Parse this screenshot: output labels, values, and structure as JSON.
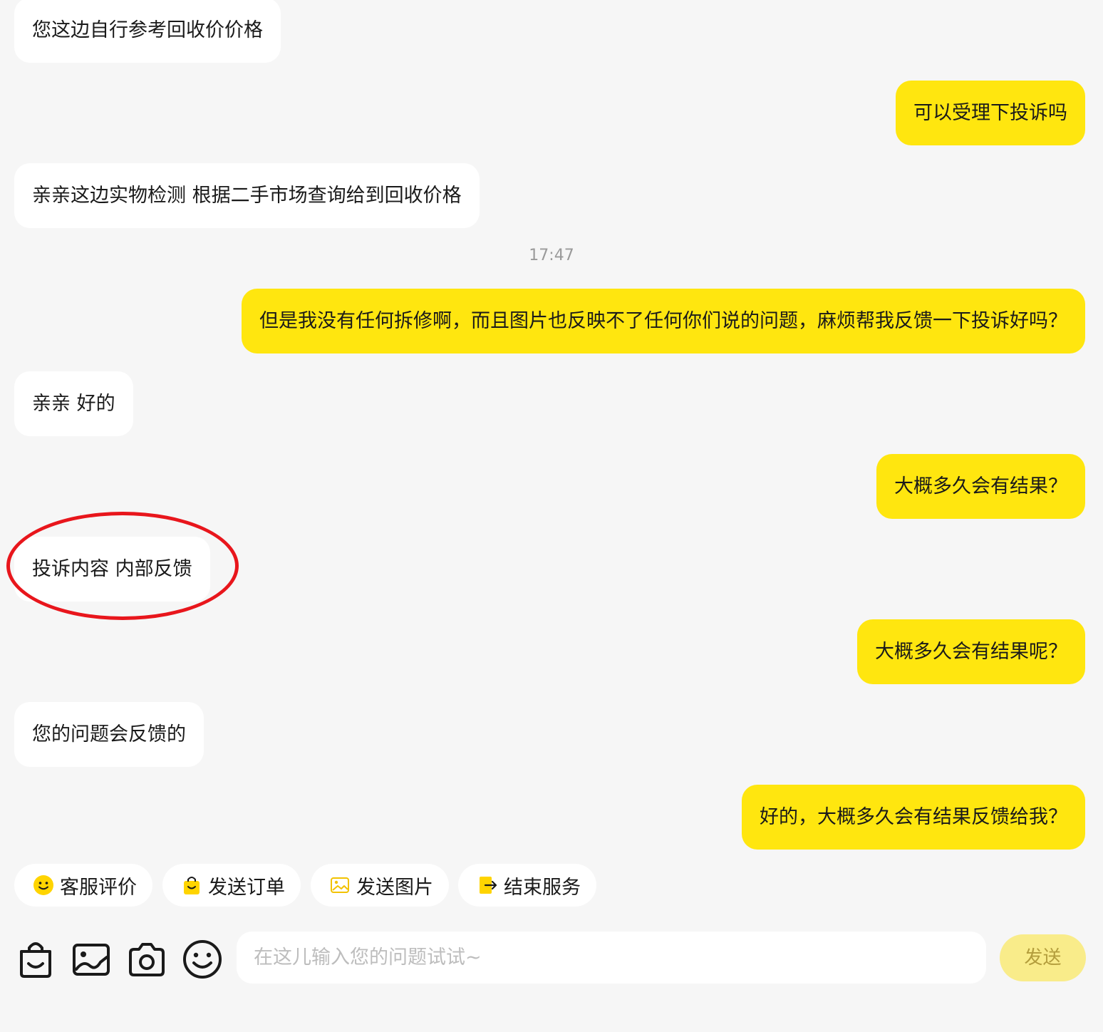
{
  "messages": [
    {
      "side": "in",
      "text": "您这边自行参考回收价价格"
    },
    {
      "side": "out",
      "text": "可以受理下投诉吗"
    },
    {
      "side": "in",
      "text": "亲亲这边实物检测 根据二手市场查询给到回收价格"
    },
    {
      "side": "out",
      "text": "但是我没有任何拆修啊，而且图片也反映不了任何你们说的问题，麻烦帮我反馈一下投诉好吗？"
    },
    {
      "side": "in",
      "text": "亲亲 好的"
    },
    {
      "side": "out",
      "text": "大概多久会有结果？"
    },
    {
      "side": "in",
      "text": "投诉内容 内部反馈"
    },
    {
      "side": "out",
      "text": "大概多久会有结果呢？"
    },
    {
      "side": "in",
      "text": "您的问题会反馈的"
    },
    {
      "side": "out",
      "text": "好的，大概多久会有结果反馈给我？"
    }
  ],
  "timestamp": "17:47",
  "quick_actions": [
    {
      "label": "客服评价",
      "icon": "smiley-icon"
    },
    {
      "label": "发送订单",
      "icon": "shopping-bag-icon"
    },
    {
      "label": "发送图片",
      "icon": "image-icon"
    },
    {
      "label": "结束服务",
      "icon": "exit-icon"
    }
  ],
  "toolbar_icons": [
    "shopping-bag-icon",
    "image-icon",
    "camera-icon",
    "emoji-icon"
  ],
  "input": {
    "placeholder": "在这儿输入您的问题试试~",
    "value": ""
  },
  "send_label": "发送",
  "colors": {
    "accent": "#ffe60f",
    "annotation": "#e8161c",
    "background": "#f6f6f6"
  }
}
